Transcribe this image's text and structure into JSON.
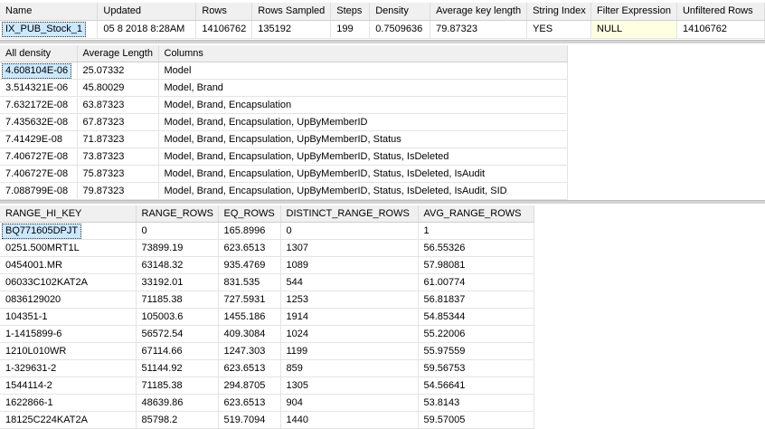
{
  "stats_header": {
    "columns": [
      "Name",
      "Updated",
      "Rows",
      "Rows Sampled",
      "Steps",
      "Density",
      "Average key length",
      "String Index",
      "Filter Expression",
      "Unfiltered Rows"
    ],
    "row": [
      "IX_PUB_Stock_1",
      "05 8 2018 8:28AM",
      "14106762",
      "135192",
      "199",
      "0.7509636",
      "79.87323",
      "YES",
      "NULL",
      "14106762"
    ]
  },
  "density_vector": {
    "columns": [
      "All density",
      "Average Length",
      "Columns"
    ],
    "rows": [
      [
        "4.608104E-06",
        "25.07332",
        "Model"
      ],
      [
        "3.514321E-06",
        "45.80029",
        "Model, Brand"
      ],
      [
        "7.632172E-08",
        "63.87323",
        "Model, Brand, Encapsulation"
      ],
      [
        "7.435632E-08",
        "67.87323",
        "Model, Brand, Encapsulation, UpByMemberID"
      ],
      [
        "7.41429E-08",
        "71.87323",
        "Model, Brand, Encapsulation, UpByMemberID, Status"
      ],
      [
        "7.406727E-08",
        "73.87323",
        "Model, Brand, Encapsulation, UpByMemberID, Status, IsDeleted"
      ],
      [
        "7.406727E-08",
        "75.87323",
        "Model, Brand, Encapsulation, UpByMemberID, Status, IsDeleted, IsAudit"
      ],
      [
        "7.088799E-08",
        "79.87323",
        "Model, Brand, Encapsulation, UpByMemberID, Status, IsDeleted, IsAudit, SID"
      ]
    ]
  },
  "histogram": {
    "columns": [
      "RANGE_HI_KEY",
      "RANGE_ROWS",
      "EQ_ROWS",
      "DISTINCT_RANGE_ROWS",
      "AVG_RANGE_ROWS"
    ],
    "rows": [
      [
        "BQ771605DPJT",
        "0",
        "165.8996",
        "0",
        "1"
      ],
      [
        "0251.500MRT1L",
        "73899.19",
        "623.6513",
        "1307",
        "56.55326"
      ],
      [
        "0454001.MR",
        "63148.32",
        "935.4769",
        "1089",
        "57.98081"
      ],
      [
        "06033C102KAT2A",
        "33192.01",
        "831.535",
        "544",
        "61.00774"
      ],
      [
        "0836129020",
        "71185.38",
        "727.5931",
        "1253",
        "56.81837"
      ],
      [
        "104351-1",
        "105003.6",
        "1455.186",
        "1914",
        "54.85344"
      ],
      [
        "1-1415899-6",
        "56572.54",
        "409.3084",
        "1024",
        "55.22006"
      ],
      [
        "1210L010WR",
        "67114.66",
        "1247.303",
        "1199",
        "55.97559"
      ],
      [
        "1-329631-2",
        "51144.92",
        "623.6513",
        "859",
        "59.56753"
      ],
      [
        "1544114-2",
        "71185.38",
        "294.8705",
        "1305",
        "54.56641"
      ],
      [
        "1622866-1",
        "48639.86",
        "623.6513",
        "904",
        "53.8143"
      ],
      [
        "18125C224KAT2A",
        "85798.2",
        "519.7094",
        "1440",
        "59.57005"
      ]
    ]
  },
  "colors": {
    "selection": "#cce8ff",
    "null_cell": "#ffffe1",
    "header": "#f0f0f0"
  }
}
